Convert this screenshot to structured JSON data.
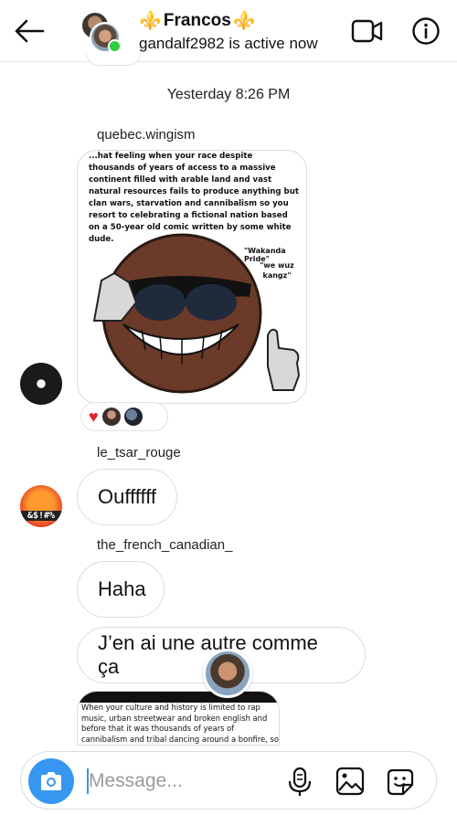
{
  "header": {
    "title_emoji_left": "⚜️",
    "title_name": "Francos",
    "title_emoji_right": "⚜️",
    "status": "gandalf2982 is active now",
    "icons": [
      "back-arrow-icon",
      "video-call-icon",
      "info-icon"
    ]
  },
  "chat": {
    "timestamp": "Yesterday 8:26 PM",
    "messages": [
      {
        "sender": "quebec.wingism",
        "type": "image",
        "meme_text": "...hat feeling when your race despite thousands of years of access to a massive continent filled with arable land and vast natural resources fails to produce anything but clan wars, starvation and cannibalism so you resort to celebrating a fictional nation based on a 50-year old comic written by some white dude.",
        "meme_label_1": "\"Wakanda Pride\"",
        "meme_label_2": "\"we wuz kangz\"",
        "reactions": [
          "heart",
          "avatar",
          "avatar"
        ]
      },
      {
        "sender": "le_tsar_rouge",
        "type": "text",
        "text": "Ouffffff",
        "avatar_text": "&$!#%"
      },
      {
        "sender": "the_french_canadian_",
        "type": "text",
        "text": "Haha"
      },
      {
        "sender": "the_french_canadian_",
        "type": "text",
        "text": "J’en ai une autre comme ça"
      },
      {
        "sender": "the_french_canadian_",
        "type": "image",
        "meme_text": "When your culture and history is limited to rap music, urban streetwear and broken english and before that it was thousands of years of cannibalism and tribal dancing around a bonfire, so to back up claims of your superiority"
      }
    ]
  },
  "composer": {
    "placeholder": "Message...",
    "icons": [
      "camera-icon",
      "microphone-icon",
      "gallery-icon",
      "sticker-icon"
    ]
  },
  "colors": {
    "accent": "#3797f0",
    "online": "#2ecc40",
    "fleur": "#f2a316",
    "heart": "#e0232b"
  }
}
